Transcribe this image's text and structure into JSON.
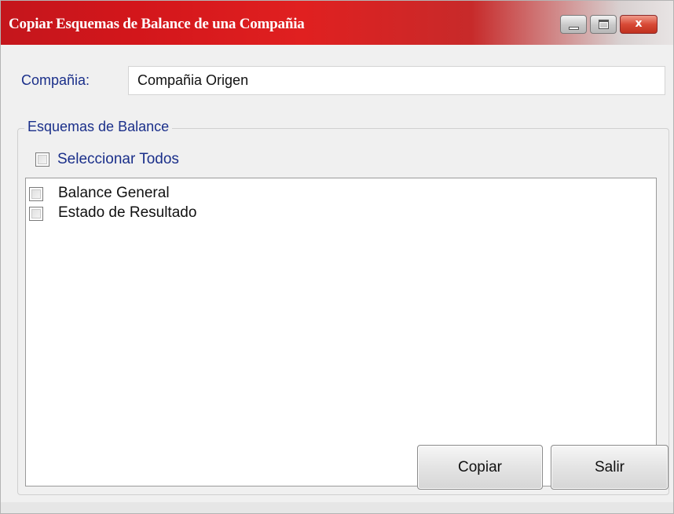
{
  "window": {
    "title": "Copiar Esquemas de Balance de una Compañia",
    "controls": {
      "minimize": "minimize",
      "maximize": "maximize",
      "close": "x"
    }
  },
  "company": {
    "label": "Compañia:",
    "value": "Compañia Origen"
  },
  "schemes_group": {
    "legend": "Esquemas de Balance",
    "select_all": {
      "label": "Seleccionar Todos",
      "checked": false
    },
    "items": [
      {
        "label": "Balance General",
        "checked": false
      },
      {
        "label": "Estado de Resultado",
        "checked": false
      }
    ]
  },
  "buttons": {
    "copy": "Copiar",
    "exit": "Salir"
  },
  "icons": {
    "minimize": "minimize-icon",
    "maximize": "maximize-icon",
    "close": "close-icon"
  },
  "colors": {
    "titlebar_accent": "#d3161b",
    "label_text": "#1a2f8a"
  }
}
